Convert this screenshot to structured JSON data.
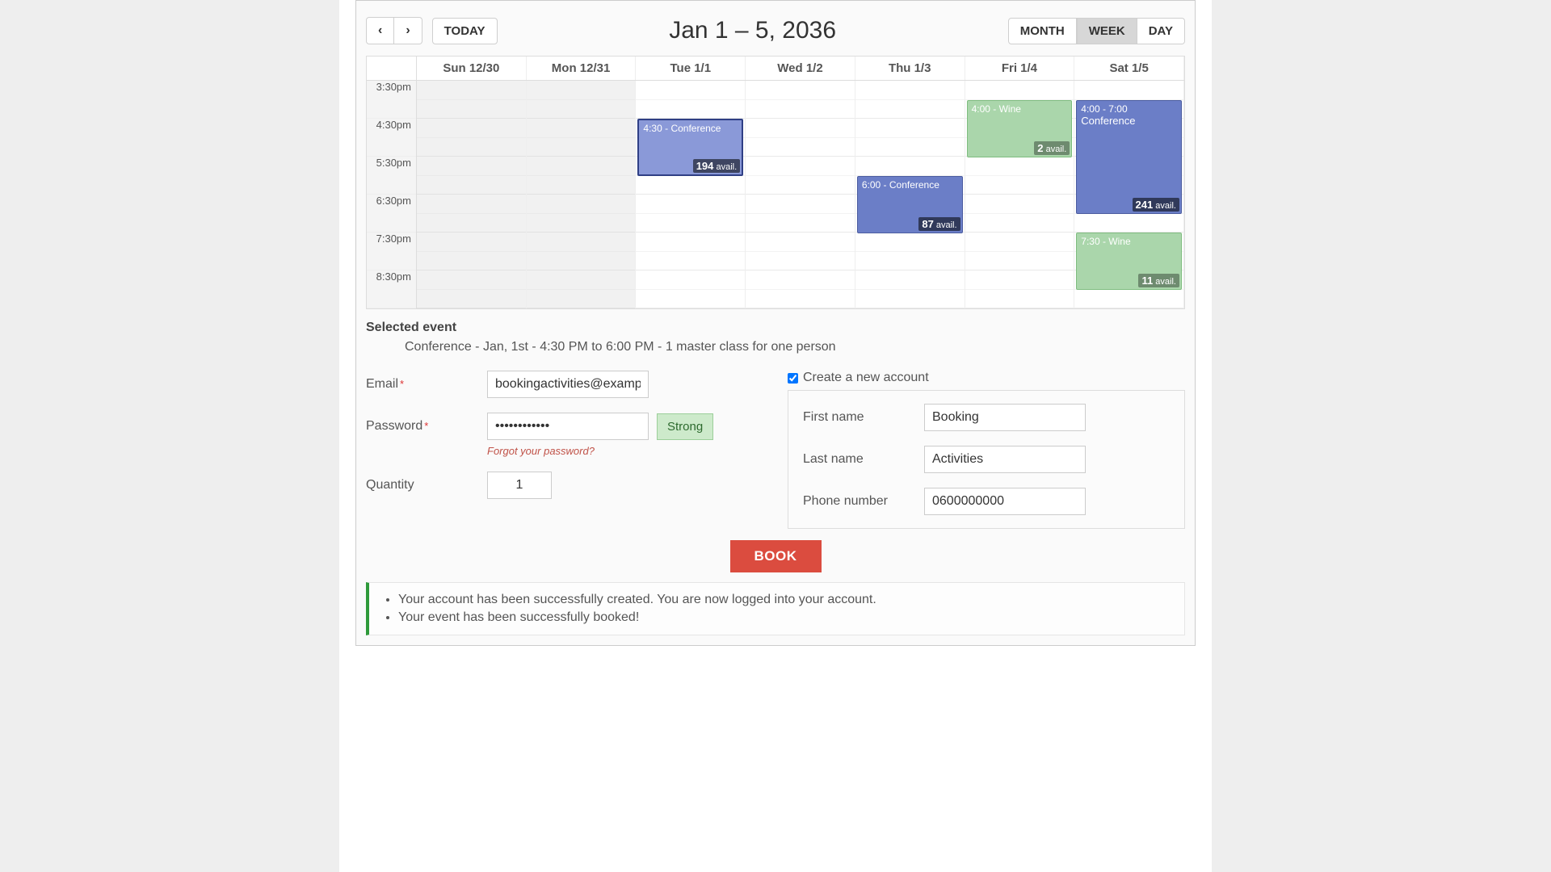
{
  "toolbar": {
    "today": "TODAY",
    "title": "Jan 1 – 5, 2036",
    "views": {
      "month": "MONTH",
      "week": "WEEK",
      "day": "DAY"
    }
  },
  "calendar": {
    "day_headers": [
      "Sun 12/30",
      "Mon 12/31",
      "Tue 1/1",
      "Wed 1/2",
      "Thu 1/3",
      "Fri 1/4",
      "Sat 1/5"
    ],
    "hours": [
      "3:30pm",
      "4:30pm",
      "5:30pm",
      "6:30pm",
      "7:30pm",
      "8:30pm"
    ],
    "events": {
      "tue_conf": {
        "label": "4:30 - Conference",
        "avail_num": "194",
        "avail_txt": "avail."
      },
      "thu_conf": {
        "label": "6:00 - Conference",
        "avail_num": "87",
        "avail_txt": "avail."
      },
      "fri_wine": {
        "label": "4:00 - Wine",
        "avail_num": "2",
        "avail_txt": "avail."
      },
      "sat_conf": {
        "time": "4:00 - 7:00",
        "title": "Conference",
        "avail_num": "241",
        "avail_txt": "avail."
      },
      "sat_wine": {
        "label": "7:30 - Wine",
        "avail_num": "11",
        "avail_txt": "avail."
      }
    }
  },
  "selected": {
    "heading": "Selected event",
    "text": "Conference - Jan, 1st - 4:30 PM to 6:00 PM - 1 master class for one person"
  },
  "form": {
    "email_label": "Email",
    "email_value": "bookingactivities@example",
    "password_label": "Password",
    "password_value": "••••••••••••",
    "strength": "Strong",
    "forgot": "Forgot your password?",
    "quantity_label": "Quantity",
    "quantity_value": "1",
    "create_account": "Create a new account",
    "first_name_label": "First name",
    "first_name_value": "Booking",
    "last_name_label": "Last name",
    "last_name_value": "Activities",
    "phone_label": "Phone number",
    "phone_value": "0600000000",
    "book": "BOOK"
  },
  "messages": [
    "Your account has been successfully created. You are now logged into your account.",
    "Your event has been successfully booked!"
  ]
}
